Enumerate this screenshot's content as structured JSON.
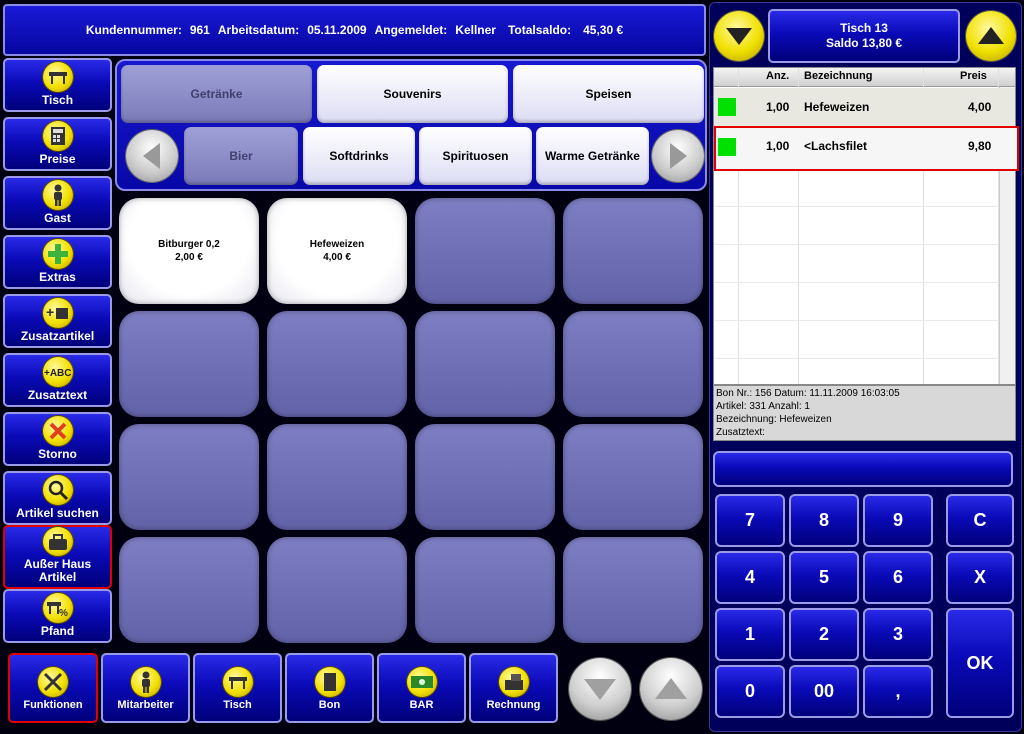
{
  "header": {
    "kunden_label": "Kundennummer:",
    "kunden_value": "961",
    "datum_label": "Arbeitsdatum:",
    "datum_value": "05.11.2009",
    "angemeldet_label": "Angemeldet:",
    "angemeldet_value": "Kellner",
    "saldo_label": "Totalsaldo:",
    "saldo_value": "45,30 €"
  },
  "sidebar": [
    {
      "label": "Tisch",
      "icon": "table-icon"
    },
    {
      "label": "Preise",
      "icon": "calculator-icon"
    },
    {
      "label": "Gast",
      "icon": "person-icon"
    },
    {
      "label": "Extras",
      "icon": "plus-icon"
    },
    {
      "label": "Zusatzartikel",
      "icon": "add-item-icon"
    },
    {
      "label": "Zusatztext",
      "icon": "abc-icon"
    },
    {
      "label": "Storno",
      "icon": "cancel-x-icon"
    },
    {
      "label": "Artikel suchen",
      "icon": "magnifier-icon"
    },
    {
      "label": "Außer Haus Artikel",
      "icon": "takeaway-icon"
    },
    {
      "label": "Pfand",
      "icon": "deposit-icon"
    }
  ],
  "categories": {
    "top": [
      "Getränke",
      "Souvenirs",
      "Speisen"
    ],
    "sub": [
      "Bier",
      "Softdrinks",
      "Spirituosen",
      "Warme Getränke"
    ]
  },
  "items": [
    {
      "name": "Bitburger 0,2",
      "price": "2,00 €"
    },
    {
      "name": "Hefeweizen",
      "price": "4,00 €"
    }
  ],
  "bottom": [
    {
      "label": "Funktionen",
      "icon": "tools-icon"
    },
    {
      "label": "Mitarbeiter",
      "icon": "person-icon"
    },
    {
      "label": "Tisch",
      "icon": "table-icon"
    },
    {
      "label": "Bon",
      "icon": "receipt-icon"
    },
    {
      "label": "BAR",
      "icon": "cash-icon"
    },
    {
      "label": "Rechnung",
      "icon": "register-icon"
    }
  ],
  "table_info": {
    "title": "Tisch 13",
    "saldo": "Saldo 13,80 €"
  },
  "order": {
    "columns": [
      "Anz.",
      "Bezeichnung",
      "Preis"
    ],
    "rows": [
      {
        "qty": "1,00",
        "name": "Hefeweizen",
        "price": "4,00"
      },
      {
        "qty": "1,00",
        "name": "<Lachsfilet",
        "price": "9,80"
      }
    ]
  },
  "details": {
    "line1": "Bon Nr.: 156   Datum: 11.11.2009 16:03:05",
    "line2": "Artikel: 331  Anzahl: 1",
    "line3": "Bezeichnung: Hefeweizen",
    "line4": "Zusatztext:"
  },
  "numpad": {
    "keys": [
      "7",
      "8",
      "9",
      "4",
      "5",
      "6",
      "1",
      "2",
      "3",
      "0",
      "00",
      ","
    ],
    "c": "C",
    "x": "X",
    "ok": "OK"
  },
  "colors": {
    "accent_red": "#e00000",
    "status_green": "#00e000",
    "panel_blue": "#0a0ab8"
  }
}
